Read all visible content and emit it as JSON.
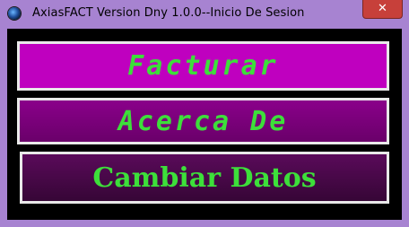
{
  "window": {
    "title": "AxiasFACT Version Dny 1.0.0--Inicio De Sesion",
    "icon": "app-globe-icon",
    "close_label": "✕"
  },
  "menu": {
    "facturar_label": "Facturar",
    "acerca_label": "Acerca De",
    "cambiar_label": "Cambiar Datos"
  },
  "colors": {
    "frame": "#a783d1",
    "client_bg": "#000000",
    "text_green": "#3ddf3a",
    "btn_facturar": "#bf00bf",
    "btn_acerca": "#7a007a",
    "btn_cambiar": "#4a084a",
    "close_red": "#c7403a"
  }
}
